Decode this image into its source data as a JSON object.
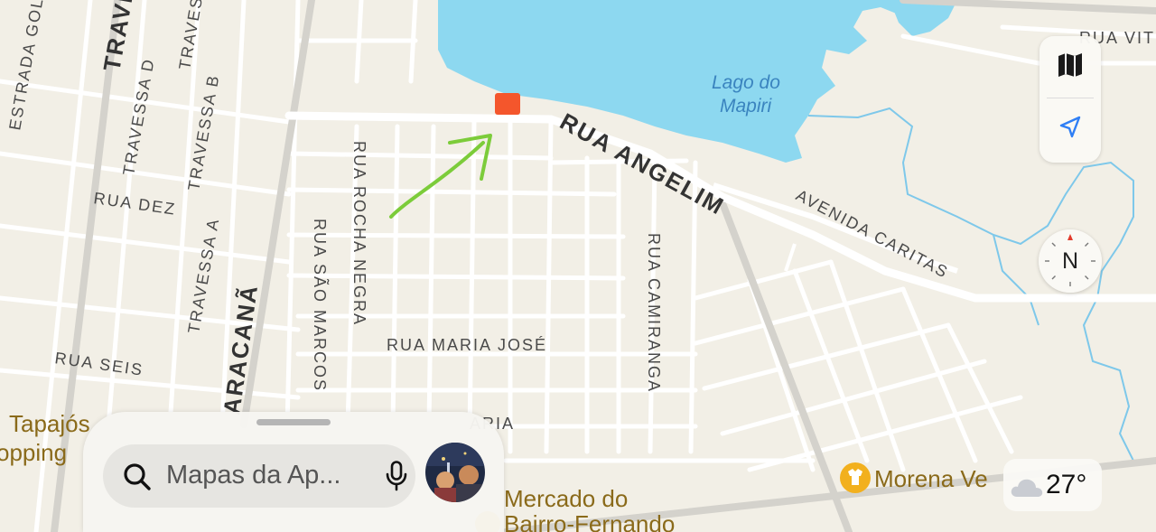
{
  "map": {
    "water_label_line1": "Lago do",
    "water_label_line2": "Mapiri",
    "streets": {
      "rua_angelim": "RUA ANGELIM",
      "avenida_caritas": "AVENIDA CARITAS",
      "rua_vit": "RUA VIT",
      "estrada_gol": "ESTRADA GOL",
      "trave": "TRAVE",
      "travessa_d": "TRAVESSA D",
      "travess": "TRAVESS",
      "travessa_b": "TRAVESSA B",
      "travessa_a": "TRAVESSA A",
      "rua_dez": "RUA DEZ",
      "rua_seis": "RUA SEIS",
      "aracana": "ARACANÃ",
      "rua_sao_marcos": "RUA SÃO MARCOS",
      "rua_rocha_negra": "RUA ROCHA NEGRA",
      "rua_maria_jose": "RUA MARIA JOSÉ",
      "rua_camiranga": "RUA CAMIRANGA",
      "aria": "ARIA"
    },
    "pois": {
      "tapajos_line1": "Tapajós",
      "tapajos_line2": "opping",
      "mercado_line1": "Mercado do",
      "mercado_line2": "Bairro-Fernando",
      "morena": "Morena Ve"
    },
    "marker_color": "#f4562c",
    "annotation_arrow_color": "#7ccc3a",
    "water_color": "#8dd8f0"
  },
  "controls": {
    "map_mode_icon": "map-icon",
    "location_icon": "location-arrow-icon",
    "compass_label": "N"
  },
  "search": {
    "placeholder": "Mapas da Ap...",
    "search_icon": "search-icon",
    "mic_icon": "mic-icon"
  },
  "weather": {
    "temperature": "27°",
    "icon": "cloud-icon"
  }
}
